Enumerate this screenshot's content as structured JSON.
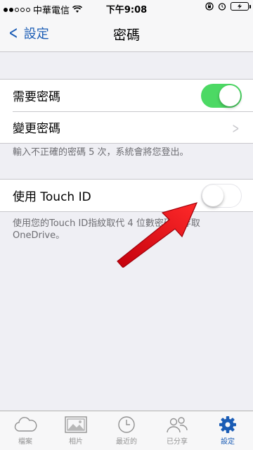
{
  "status_bar": {
    "carrier": "中華電信",
    "time": "下午9:08"
  },
  "nav": {
    "back_label": "設定",
    "title": "密碼"
  },
  "passcode_group": {
    "require_label": "需要密碼",
    "require_enabled": true,
    "change_label": "變更密碼"
  },
  "passcode_footer": "輸入不正確的密碼 5 次，系統會將您登出。",
  "touchid_group": {
    "label": "使用 Touch ID",
    "enabled": false
  },
  "touchid_footer": {
    "line1": "使用您的Touch ID指紋取代 4 位數密碼來存取",
    "line2": "OneDrive。"
  },
  "tabs": [
    {
      "label": "檔案",
      "icon": "cloud-icon"
    },
    {
      "label": "相片",
      "icon": "photos-icon"
    },
    {
      "label": "最近的",
      "icon": "clock-icon"
    },
    {
      "label": "已分享",
      "icon": "people-icon"
    },
    {
      "label": "設定",
      "icon": "gear-icon",
      "active": true
    }
  ],
  "colors": {
    "accent": "#1a5cb5",
    "toggle_on": "#4cd964",
    "arrow": "#e8121d"
  }
}
